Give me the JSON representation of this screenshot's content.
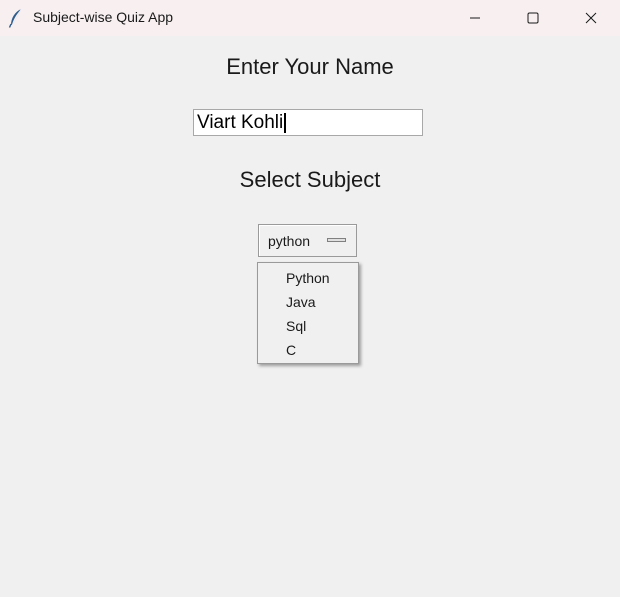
{
  "window": {
    "title": "Subject-wise Quiz App",
    "icon": "feather-icon",
    "controls": [
      "minimize-icon",
      "maximize-icon",
      "close-icon"
    ]
  },
  "form": {
    "name_heading": "Enter Your Name",
    "name_value": "Viart Kohli",
    "subject_heading": "Select Subject",
    "subject_selected": "python",
    "subject_options": [
      "Python",
      "Java",
      "Sql",
      "C"
    ]
  }
}
